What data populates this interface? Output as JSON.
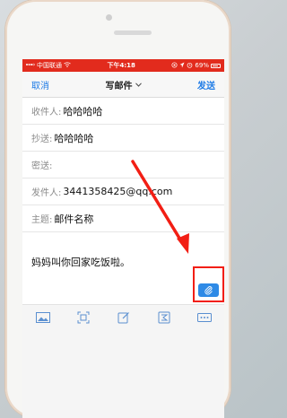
{
  "status_bar": {
    "carrier": "中国联通",
    "network": "令",
    "time": "下午4:18",
    "battery": "69%"
  },
  "nav": {
    "cancel": "取消",
    "title": "写邮件",
    "send": "发送"
  },
  "fields": {
    "to_label": "收件人:",
    "to_value": "哈哈哈哈",
    "cc_label": "抄送:",
    "cc_value": "哈哈哈哈",
    "bcc_label": "密送:",
    "from_label": "发件人:",
    "from_value": "3441358425@qq.com",
    "subject_label": "主题:",
    "subject_value": "邮件名称"
  },
  "body": "妈妈叫你回家吃饭啦。",
  "colors": {
    "accent": "#1e7be6",
    "status_bar": "#e22b1d",
    "annotation": "#f21e14",
    "attach_button": "#2e8ae6"
  },
  "icons": [
    "image-icon",
    "scan-icon",
    "edit-icon",
    "formula-icon",
    "more-icon",
    "paperclip-icon"
  ]
}
